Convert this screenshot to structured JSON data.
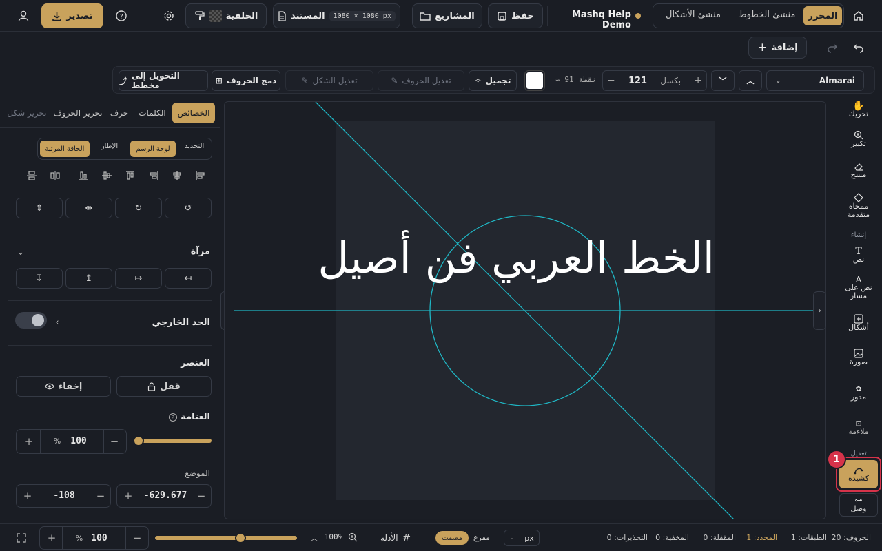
{
  "topbar": {
    "home_icon": "home-icon",
    "modes": [
      "المحرر",
      "منشئ الخطوط",
      "منشئ الأشكال"
    ],
    "project_name": "Mashq Help Demo",
    "save": "حفظ",
    "projects": "المشاريع",
    "document": "المستند",
    "doc_size": "1080 × 1080 px",
    "background": "الخلفية",
    "export": "تصدير"
  },
  "row2": {
    "add": "إضافة"
  },
  "toolbar": {
    "font": "Almarai",
    "size_value": "121",
    "size_unit": "بكسل",
    "points": "≈ 91 نقطة",
    "beautify": "تجميل",
    "edit_letters": "تعديل الحروف",
    "edit_shape": "تعديل الشكل",
    "merge_letters": "دمج الحروف",
    "convert_outline": "التحويل إلى مخطط"
  },
  "left": {
    "tabs": [
      "الخصائص",
      "الكلمات",
      "حرف",
      "تحرير الحروف",
      "تحرير شكل"
    ],
    "align_to": [
      "التحديد",
      "لوحة الرسم",
      "الإطار",
      "الحافة المرئية"
    ],
    "mirror": "مرآة",
    "stroke": "الحد الخارجي",
    "element": "العنصر",
    "lock": "قفل",
    "hide": "إخفاء",
    "opacity": "العتامة",
    "opacity_value": "100",
    "percent": "%",
    "position": "الموضع",
    "pos_x": "-629.677",
    "pos_y": "-108"
  },
  "canvas": {
    "text": "الخط العربي فن أصيل"
  },
  "right": {
    "move": "تحريك",
    "zoom": "تكبير",
    "erase": "مسح",
    "advanced_eraser": "ممحاة متقدمة",
    "create": "إنشاء",
    "text": "نص",
    "text_on_path": "نص على مسار",
    "shapes": "أشكال",
    "image": "صورة",
    "round": "مدور",
    "fit": "ملاءمة",
    "edit": "تعديل",
    "kashida": "كشيدة",
    "connect": "وصل",
    "badge": "1"
  },
  "bottom": {
    "zoom_value": "100",
    "percent": "%",
    "zoom_pct": "100%",
    "zoom_slider": 0.6,
    "guides": "الأدلة",
    "flattened": "مصمت",
    "hollow": "مفرغ",
    "unit": "px",
    "letters": "الحروف: 20",
    "layers": "الطبقات: 1",
    "selected": "المحدد: 1",
    "locked": "المقفلة: 0",
    "hidden": "المخفية: 0",
    "warnings": "التحذيرات: 0"
  },
  "colors": {
    "accent": "#c9a25c",
    "guide": "#1fb6c4",
    "badge": "#d6334a"
  }
}
